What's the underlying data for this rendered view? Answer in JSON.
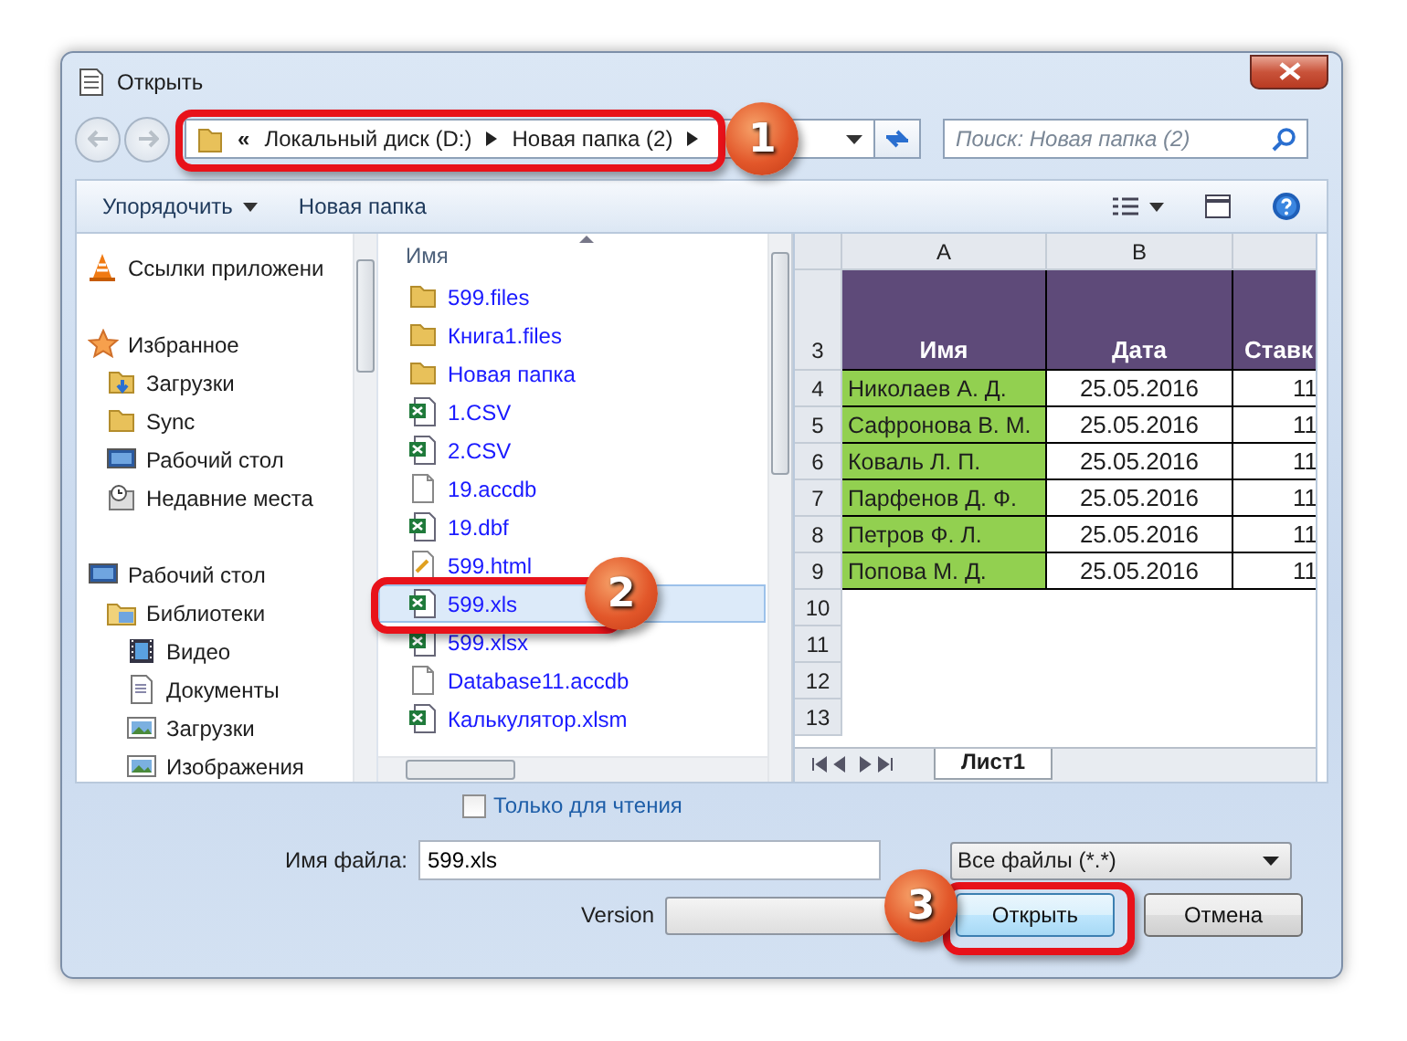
{
  "window": {
    "title": "Открыть"
  },
  "address": {
    "overflow": "«",
    "path": [
      "Локальный диск (D:)",
      "Новая папка (2)"
    ]
  },
  "search": {
    "placeholder": "Поиск: Новая папка (2)"
  },
  "toolbar": [
    {
      "label": "Упорядочить",
      "kind": "menu"
    },
    {
      "label": "Новая папка",
      "kind": "plain"
    }
  ],
  "nav_pane": {
    "groups": [
      {
        "label": "Ссылки приложени"
      },
      {
        "label": "Избранное",
        "children": [
          {
            "label": "Загрузки"
          },
          {
            "label": "Sync"
          },
          {
            "label": "Рабочий стол"
          },
          {
            "label": "Недавние места"
          }
        ]
      },
      {
        "label": "Рабочий стол",
        "children": [
          {
            "label": "Библиотеки",
            "children": [
              {
                "label": "Видео"
              },
              {
                "label": "Документы"
              },
              {
                "label": "Загрузки"
              },
              {
                "label": "Изображения"
              }
            ]
          }
        ]
      }
    ]
  },
  "file_list": {
    "column": "Имя",
    "files": [
      {
        "name": "599.files",
        "kind": "folder",
        "selected": false
      },
      {
        "name": "Книга1.files",
        "kind": "folder",
        "selected": false
      },
      {
        "name": "Новая папка",
        "kind": "folder",
        "selected": false
      },
      {
        "name": "1.CSV",
        "kind": "spreadsheet",
        "selected": false
      },
      {
        "name": "2.CSV",
        "kind": "spreadsheet",
        "selected": false
      },
      {
        "name": "19.accdb",
        "kind": "blank",
        "selected": false
      },
      {
        "name": "19.dbf",
        "kind": "spreadsheet",
        "selected": false
      },
      {
        "name": "599.html",
        "kind": "web",
        "selected": false
      },
      {
        "name": "599.xls",
        "kind": "spreadsheet",
        "selected": true
      },
      {
        "name": "599.xlsx",
        "kind": "spreadsheet",
        "selected": false
      },
      {
        "name": "Database11.accdb",
        "kind": "blank",
        "selected": false
      },
      {
        "name": "Калькулятор.xlsm",
        "kind": "spreadsheet",
        "selected": false
      }
    ]
  },
  "preview": {
    "columns": [
      "A",
      "B"
    ],
    "header_row": "3",
    "headers": [
      "Имя",
      "Дата",
      "Ставк"
    ],
    "rows": [
      {
        "num": "4",
        "name": "Николаев А. Д.",
        "date": "25.05.2016",
        "value": "11"
      },
      {
        "num": "5",
        "name": "Сафронова В. М.",
        "date": "25.05.2016",
        "value": "11"
      },
      {
        "num": "6",
        "name": "Коваль Л. П.",
        "date": "25.05.2016",
        "value": "11"
      },
      {
        "num": "7",
        "name": "Парфенов Д. Ф.",
        "date": "25.05.2016",
        "value": "11"
      },
      {
        "num": "8",
        "name": "Петров Ф. Л.",
        "date": "25.05.2016",
        "value": "11"
      },
      {
        "num": "9",
        "name": "Попова М. Д.",
        "date": "25.05.2016",
        "value": "11"
      }
    ],
    "empty_rows": [
      "10",
      "11",
      "12",
      "13"
    ],
    "sheet_tab": "Лист1"
  },
  "read_only": {
    "label": "Только для чтения",
    "checked": false
  },
  "file_name": {
    "label": "Имя файла:",
    "value": "599.xls"
  },
  "file_type": {
    "value": "Все файлы (*.*)"
  },
  "version": {
    "label": "Version"
  },
  "buttons": [
    {
      "label": "Открыть",
      "kind": "primary"
    },
    {
      "label": "Отмена",
      "kind": "normal"
    }
  ],
  "callouts": [
    {
      "number": "1"
    },
    {
      "number": "2"
    },
    {
      "number": "3"
    }
  ]
}
